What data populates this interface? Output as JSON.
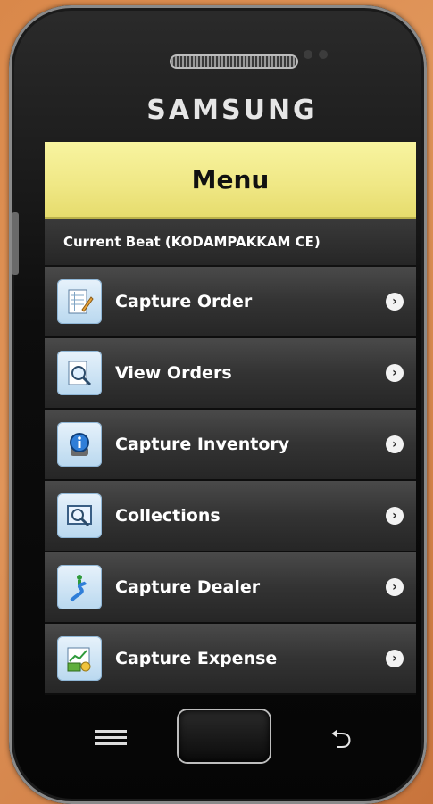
{
  "device": {
    "brand": "SAMSUNG"
  },
  "header": {
    "title": "Menu"
  },
  "beat": {
    "label": "Current Beat (KODAMPAKKAM CE)"
  },
  "menu": {
    "items": [
      {
        "label": "Capture Order",
        "icon": "order-form-icon"
      },
      {
        "label": "View Orders",
        "icon": "magnifier-document-icon"
      },
      {
        "label": "Capture Inventory",
        "icon": "info-icon"
      },
      {
        "label": "Collections",
        "icon": "search-monitor-icon"
      },
      {
        "label": "Capture Dealer",
        "icon": "road-person-icon"
      },
      {
        "label": "Capture Expense",
        "icon": "money-chart-icon"
      }
    ]
  },
  "colors": {
    "header_bg": "#efe784",
    "list_bg": "#333333",
    "text": "#ffffff"
  }
}
